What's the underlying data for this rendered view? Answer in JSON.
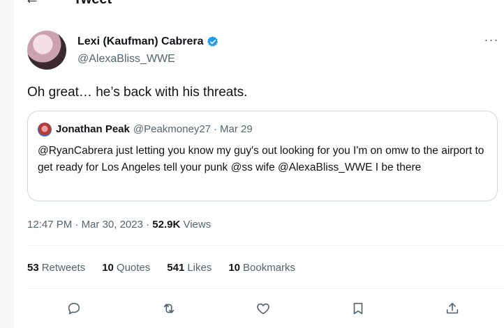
{
  "header": {
    "title": "Tweet",
    "back_glyph": "←"
  },
  "author": {
    "display_name": "Lexi (Kaufman) Cabrera",
    "handle": "@AlexaBliss_WWE",
    "verified_color": "#1d9bf0"
  },
  "more_glyph": "···",
  "tweet": {
    "text": "Oh great… he’s back with his threats."
  },
  "quote": {
    "name": "Jonathan Peak",
    "handle": "@Peakmoney27",
    "separator": "·",
    "date": "Mar 29",
    "text": "@RyanCabrera  just letting you know my guy's out looking for you I'm on omw to the airport to get ready for Los Angeles tell your punk @ss wife @AlexaBliss_WWE  I be there"
  },
  "meta": {
    "time": "12:47 PM",
    "sep1": " · ",
    "date": "Mar 30, 2023",
    "sep2": " · ",
    "views_count": "52.9K",
    "views_label": " Views"
  },
  "stats": {
    "retweets": {
      "count": "53",
      "label": "Retweets"
    },
    "quotes": {
      "count": "10",
      "label": "Quotes"
    },
    "likes": {
      "count": "541",
      "label": "Likes"
    },
    "bookmarks": {
      "count": "10",
      "label": "Bookmarks"
    }
  },
  "actions": [
    "reply-icon",
    "retweet-icon",
    "like-icon",
    "bookmark-icon",
    "share-icon"
  ]
}
